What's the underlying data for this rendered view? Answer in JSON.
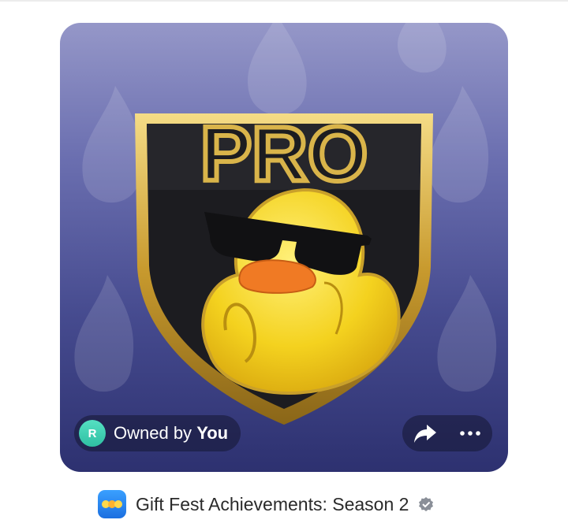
{
  "nft_card": {
    "artwork_text": "PRO",
    "owner": {
      "avatar_letter": "R",
      "label_prefix": "Owned by",
      "owner_name": "You",
      "avatar_color": "#3ccfb0"
    },
    "actions": [
      {
        "name": "share",
        "icon": "share-arrow-icon"
      },
      {
        "name": "more",
        "icon": "more-dots-icon"
      }
    ]
  },
  "collection": {
    "name": "Gift Fest Achievements: Season 2",
    "icon": "collection-app-icon",
    "verified_icon": "verified-badge-icon"
  },
  "colors": {
    "card_bg_top": "#9597c8",
    "card_bg_bottom": "#2d3170",
    "gold": "#d9b44a",
    "duck_yellow": "#f4d21f",
    "beak_orange": "#f07a24"
  }
}
